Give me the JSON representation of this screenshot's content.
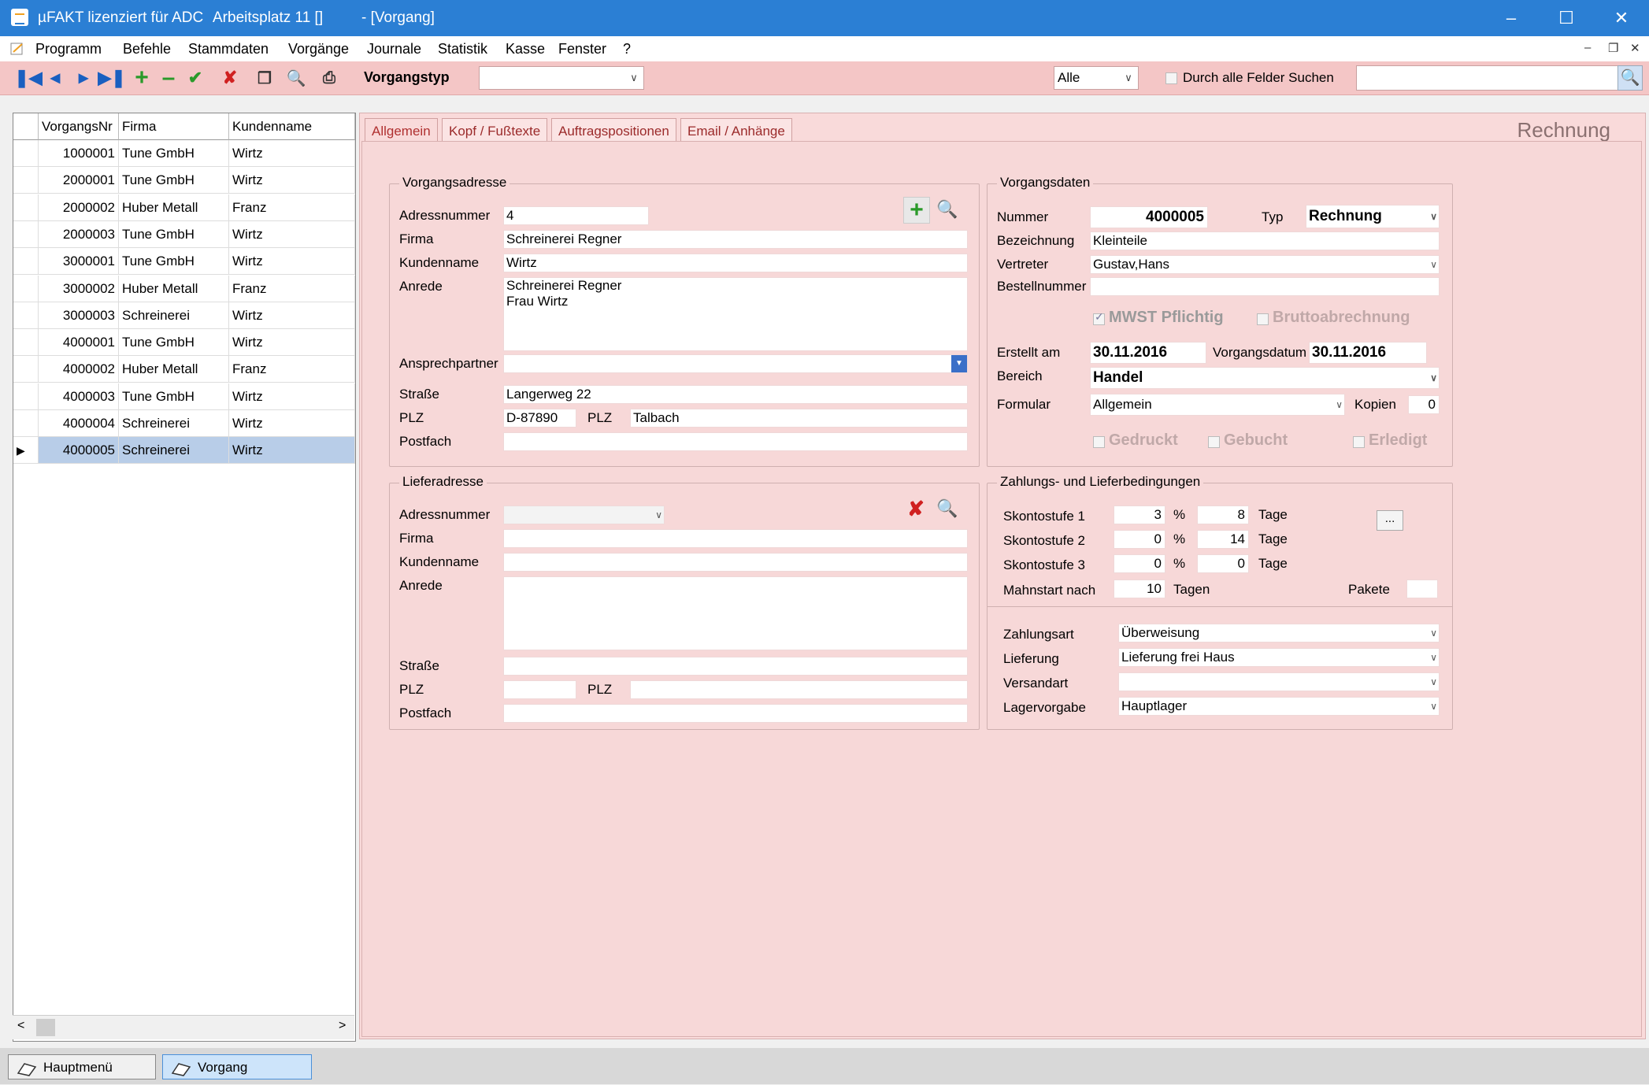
{
  "window": {
    "title_app": "µFAKT lizenziert für ADC",
    "title_workplace": "Arbeitsplatz 11 []",
    "title_doc": "- [Vorgang]"
  },
  "menu": [
    "Programm",
    "Befehle",
    "Stammdaten",
    "Vorgänge",
    "Journale",
    "Statistik",
    "Kasse",
    "Fenster",
    "?"
  ],
  "toolbar": {
    "vorgangstyp_label": "Vorgangstyp",
    "vorgangstyp_value": "",
    "filter_value": "Alle",
    "search_all_label": "Durch alle Felder Suchen",
    "search_value": ""
  },
  "grid": {
    "headers": [
      "VorgangsNr",
      "Firma",
      "Kundenname"
    ],
    "rows": [
      {
        "nr": "1000001",
        "firma": "Tune GmbH",
        "kunde": "Wirtz"
      },
      {
        "nr": "2000001",
        "firma": "Tune GmbH",
        "kunde": "Wirtz"
      },
      {
        "nr": "2000002",
        "firma": "Huber Metall",
        "kunde": "Franz"
      },
      {
        "nr": "2000003",
        "firma": "Tune GmbH",
        "kunde": "Wirtz"
      },
      {
        "nr": "3000001",
        "firma": "Tune GmbH",
        "kunde": "Wirtz"
      },
      {
        "nr": "3000002",
        "firma": "Huber Metall",
        "kunde": "Franz"
      },
      {
        "nr": "3000003",
        "firma": "Schreinerei",
        "kunde": "Wirtz"
      },
      {
        "nr": "4000001",
        "firma": "Tune GmbH",
        "kunde": "Wirtz"
      },
      {
        "nr": "4000002",
        "firma": "Huber Metall",
        "kunde": "Franz"
      },
      {
        "nr": "4000003",
        "firma": "Tune GmbH",
        "kunde": "Wirtz"
      },
      {
        "nr": "4000004",
        "firma": "Schreinerei",
        "kunde": "Wirtz"
      },
      {
        "nr": "4000005",
        "firma": "Schreinerei",
        "kunde": "Wirtz"
      }
    ]
  },
  "tabs": [
    "Allgemein",
    "Kopf / Fußtexte",
    "Auftragspositionen",
    "Email / Anhänge"
  ],
  "doc_type_heading": "Rechnung",
  "vorgangsadresse": {
    "title": "Vorgangsadresse",
    "adressnummer_label": "Adressnummer",
    "adressnummer": "4",
    "firma_label": "Firma",
    "firma": "Schreinerei Regner",
    "kundenname_label": "Kundenname",
    "kundenname": "Wirtz",
    "anrede_label": "Anrede",
    "anrede_line1": "Schreinerei Regner",
    "anrede_line2": "Frau Wirtz",
    "ansprechpartner_label": "Ansprechpartner",
    "ansprechpartner": "",
    "strasse_label": "Straße",
    "strasse": "Langerweg 22",
    "plz_label": "PLZ",
    "plz": "D-87890",
    "ort_label": "PLZ",
    "ort": "Talbach",
    "postfach_label": "Postfach",
    "postfach": ""
  },
  "lieferadresse": {
    "title": "Lieferadresse",
    "adressnummer_label": "Adressnummer",
    "firma_label": "Firma",
    "kundenname_label": "Kundenname",
    "anrede_label": "Anrede",
    "strasse_label": "Straße",
    "plz_label": "PLZ",
    "ort_label": "PLZ",
    "postfach_label": "Postfach"
  },
  "vorgangsdaten": {
    "title": "Vorgangsdaten",
    "nummer_label": "Nummer",
    "nummer": "4000005",
    "typ_label": "Typ",
    "typ": "Rechnung",
    "bezeichnung_label": "Bezeichnung",
    "bezeichnung": "Kleinteile",
    "vertreter_label": "Vertreter",
    "vertreter": "Gustav,Hans",
    "bestellnummer_label": "Bestellnummer",
    "bestellnummer": "",
    "mwst_label": "MWST Pflichtig",
    "brutto_label": "Bruttoabrechnung",
    "erstellt_label": "Erstellt am",
    "erstellt": "30.11.2016",
    "vorgangsdatum_label": "Vorgangsdatum",
    "vorgangsdatum": "30.11.2016",
    "bereich_label": "Bereich",
    "bereich": "Handel",
    "formular_label": "Formular",
    "formular": "Allgemein",
    "kopien_label": "Kopien",
    "kopien": "0",
    "gedruckt_label": "Gedruckt",
    "gebucht_label": "Gebucht",
    "erledigt_label": "Erledigt"
  },
  "zahlung": {
    "title": "Zahlungs- und Lieferbedingungen",
    "sk1_label": "Skontostufe 1",
    "sk1_pct": "3",
    "sk1_days": "8",
    "sk2_label": "Skontostufe 2",
    "sk2_pct": "0",
    "sk2_days": "14",
    "sk3_label": "Skontostufe 3",
    "sk3_pct": "0",
    "sk3_days": "0",
    "pct_sign": "%",
    "tage": "Tage",
    "mahnstart_label": "Mahnstart nach",
    "mahnstart": "10",
    "tagen": "Tagen",
    "pakete_label": "Pakete",
    "pakete": "",
    "more_button": "...",
    "zahlungsart_label": "Zahlungsart",
    "zahlungsart": "Überweisung",
    "lieferung_label": "Lieferung",
    "lieferung": "Lieferung frei Haus",
    "versandart_label": "Versandart",
    "versandart": "",
    "lager_label": "Lagervorgabe",
    "lager": "Hauptlager"
  },
  "taskbar": [
    "Hauptmenü",
    "Vorgang"
  ]
}
